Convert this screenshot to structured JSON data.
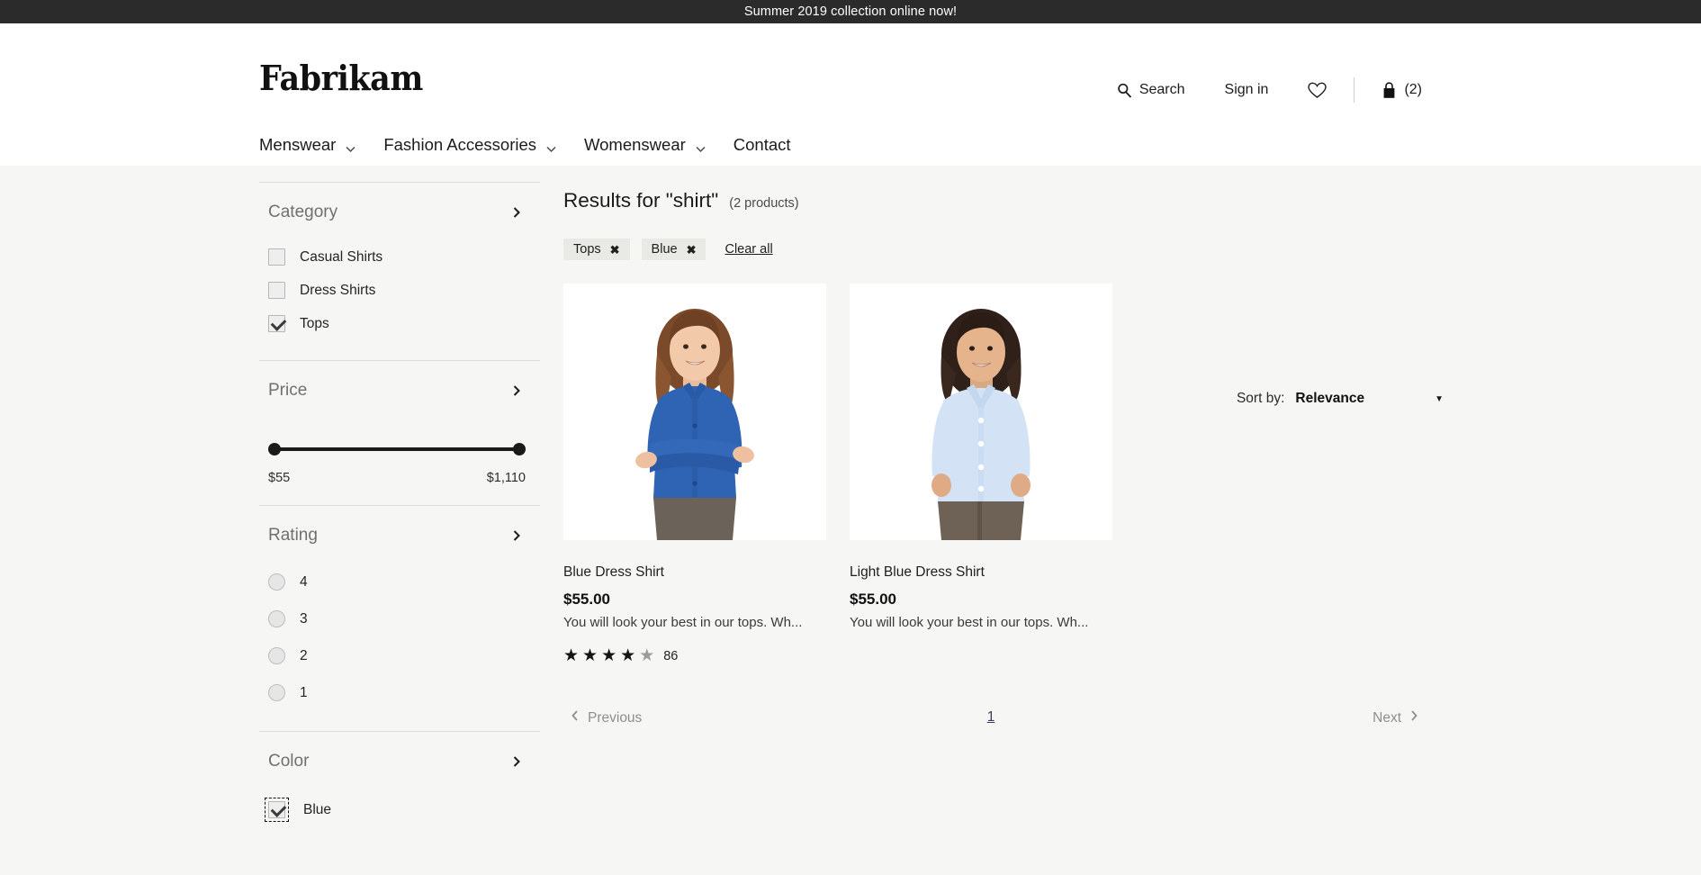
{
  "announcement": {
    "text": "Summer 2019 collection online now!"
  },
  "header": {
    "logo": "Fabrikam",
    "utils": {
      "search_label": "Search",
      "signin_label": "Sign in",
      "wishlist_icon": "heart-icon",
      "cart_icon": "shopping-bag-icon",
      "cart_count": "(2)"
    },
    "nav": [
      {
        "label": "Menswear",
        "has_dropdown": true
      },
      {
        "label": "Fashion Accessories",
        "has_dropdown": true
      },
      {
        "label": "Womenswear",
        "has_dropdown": true
      },
      {
        "label": "Contact",
        "has_dropdown": false
      }
    ]
  },
  "sidebar": {
    "category": {
      "title": "Category",
      "options": [
        {
          "label": "Casual Shirts",
          "checked": false
        },
        {
          "label": "Dress Shirts",
          "checked": false
        },
        {
          "label": "Tops",
          "checked": true
        }
      ]
    },
    "price": {
      "title": "Price",
      "min_label": "$55",
      "max_label": "$1,110"
    },
    "rating": {
      "title": "Rating",
      "options": [
        {
          "label": "4",
          "selected": false
        },
        {
          "label": "3",
          "selected": false
        },
        {
          "label": "2",
          "selected": false
        },
        {
          "label": "1",
          "selected": false
        }
      ]
    },
    "color": {
      "title": "Color",
      "options": [
        {
          "label": "Blue",
          "checked": true,
          "focused": true
        }
      ]
    }
  },
  "results": {
    "title": "Results for \"shirt\"",
    "count_label": "(2 products)",
    "active_filters": [
      {
        "label": "Tops",
        "remove_icon": "close-icon"
      },
      {
        "label": "Blue",
        "remove_icon": "close-icon"
      }
    ],
    "clear_all_label": "Clear all",
    "sort": {
      "label": "Sort by:",
      "value": "Relevance"
    },
    "products": [
      {
        "title": "Blue Dress Shirt",
        "price": "$55.00",
        "description": "You will look your best in our tops. Wh...",
        "rating": {
          "filled": 4,
          "total": 5,
          "count": "86"
        },
        "image": "woman-blue-dress-shirt"
      },
      {
        "title": "Light Blue Dress Shirt",
        "price": "$55.00",
        "description": "You will look your best in our tops. Wh...",
        "rating": null,
        "image": "woman-light-blue-dress-shirt"
      }
    ],
    "pagination": {
      "previous_label": "Previous",
      "next_label": "Next",
      "current_page": "1"
    }
  },
  "colors": {
    "announce_bg": "#2b2b2b",
    "page_bg": "#f6f6f4",
    "chip_bg": "#e9e9e6",
    "accent_dark": "#1a1a1a",
    "muted_text": "#70706e"
  }
}
